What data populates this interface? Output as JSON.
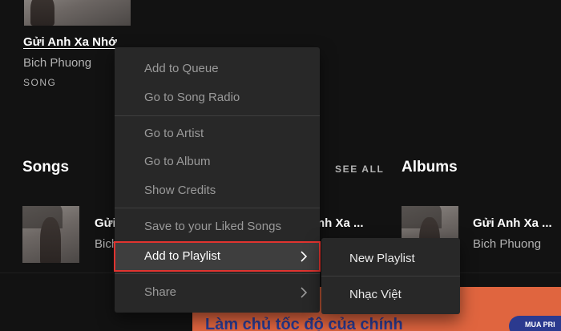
{
  "top_result": {
    "title": "Gửi Anh Xa Nhớ",
    "artist": "Bich Phuong",
    "type": "SONG"
  },
  "songs": {
    "heading": "Songs",
    "see_all": "SEE ALL",
    "row_title_cut": "Gửi",
    "row_artist_cut": "Bich",
    "row_title_right": "nh Xa ..."
  },
  "albums": {
    "heading": "Albums",
    "item_title": "Gửi Anh Xa ...",
    "item_artist": "Bich Phuong"
  },
  "context_menu": {
    "items": [
      "Add to Queue",
      "Go to Song Radio",
      "Go to Artist",
      "Go to Album",
      "Show Credits",
      "Save to your Liked Songs",
      "Add to Playlist",
      "Share"
    ],
    "active_item": "Add to Playlist",
    "highlight_color": "#e0332f"
  },
  "submenu": {
    "items": [
      "New Playlist",
      "Nhạc Việt"
    ]
  },
  "ad": {
    "text": "Làm chủ tốc độ của chính",
    "button": "MUA PRI"
  },
  "icons": {
    "submenu_arrow": "chevron-right-icon"
  },
  "colors": {
    "background": "#121212",
    "menu_bg": "#282828",
    "ad_bg": "#e0653f",
    "ad_accent": "#2b3a8f"
  }
}
